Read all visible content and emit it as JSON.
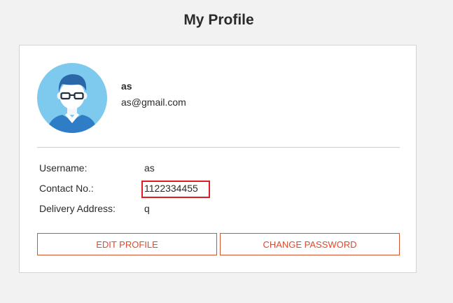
{
  "page": {
    "title": "My Profile"
  },
  "profile": {
    "name": "as",
    "email": "as@gmail.com",
    "avatar_icon": "user-avatar-with-glasses-icon"
  },
  "details": [
    {
      "label": "Username:",
      "value": "as"
    },
    {
      "label": "Contact No.:",
      "value": "1122334455"
    },
    {
      "label": "Delivery Address:",
      "value": "q"
    }
  ],
  "actions": {
    "edit_profile_label": "EDIT PROFILE",
    "change_password_label": "CHANGE PASSWORD"
  },
  "colors": {
    "accent": "#e0492a",
    "highlight": "#d92026",
    "avatar_bg": "#7ec9ee"
  }
}
